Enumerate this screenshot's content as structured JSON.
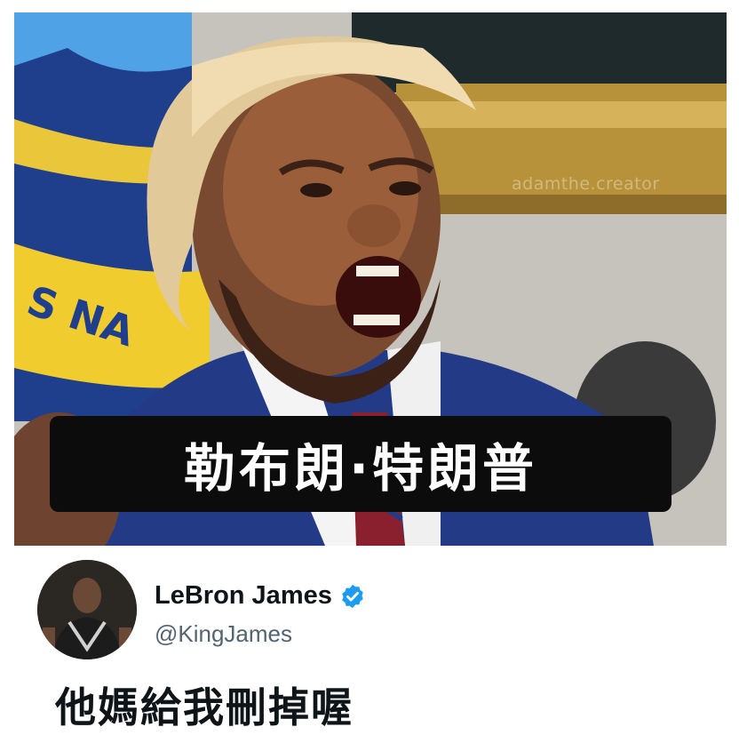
{
  "image": {
    "watermark": "adamthe.creator"
  },
  "caption": {
    "text": "勒布朗·特朗普"
  },
  "tweet": {
    "display_name": "LeBron James",
    "handle": "@KingJames",
    "verified": true,
    "text": "他媽給我刪掉喔"
  },
  "colors": {
    "caption_bar": "#0c0c0c",
    "caption_text": "#ffffff",
    "verified_badge": "#1d9bf0",
    "name": "#0f1419",
    "handle": "#536471"
  },
  "icons": {
    "verified": "verified-badge-icon"
  }
}
